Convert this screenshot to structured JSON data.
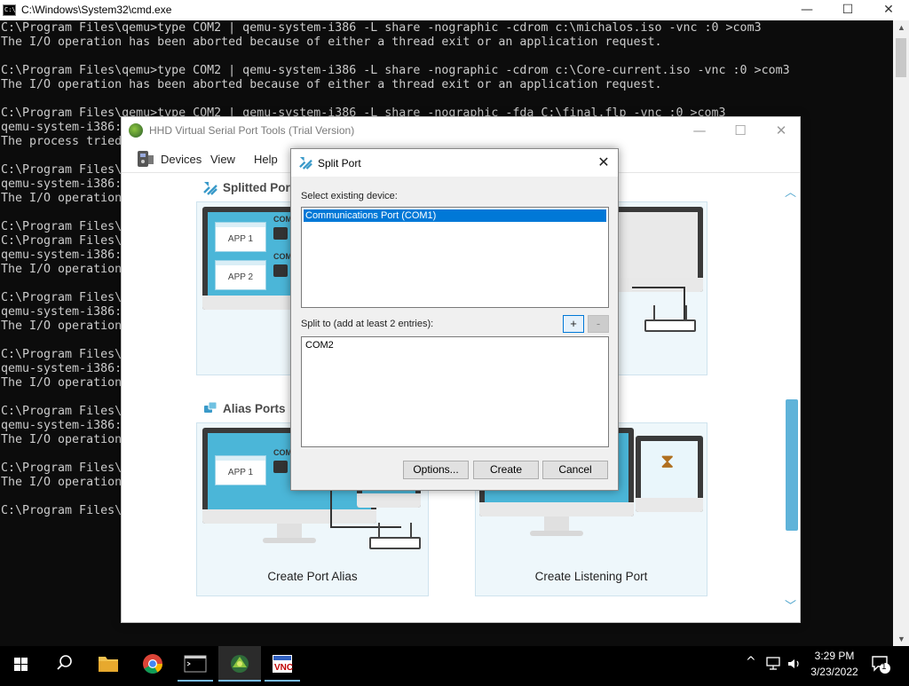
{
  "cmd": {
    "title": "C:\\Windows\\System32\\cmd.exe",
    "icon": "cmd-icon",
    "icon_text": "C:\\_",
    "lines": [
      "C:\\Program Files\\qemu>type COM2 | qemu-system-i386 -L share -nographic -cdrom c:\\michalos.iso -vnc :0 >com3",
      "The I/O operation has been aborted because of either a thread exit or an application request.",
      "",
      "C:\\Program Files\\qemu>type COM2 | qemu-system-i386 -L share -nographic -cdrom c:\\Core-current.iso -vnc :0 >com3",
      "The I/O operation has been aborted because of either a thread exit or an application request.",
      "",
      "C:\\Program Files\\qemu>type COM2 | qemu-system-i386 -L share -nographic -fda C:\\final.flp -vnc :0 >com3",
      "qemu-system-i386:",
      "The process tried",
      "",
      "C:\\Program Files\\",
      "qemu-system-i386:",
      "The I/O operation",
      "",
      "C:\\Program Files\\",
      "C:\\Program Files\\",
      "qemu-system-i386:",
      "The I/O operation",
      "",
      "C:\\Program Files\\",
      "qemu-system-i386:",
      "The I/O operation",
      "",
      "C:\\Program Files\\",
      "qemu-system-i386:",
      "The I/O operation",
      "",
      "C:\\Program Files\\",
      "qemu-system-i386:",
      "The I/O operation",
      "",
      "C:\\Program Files\\",
      "The I/O operation",
      "",
      "C:\\Program Files\\"
    ]
  },
  "caption": {
    "minimize": "—",
    "maximize": "☐",
    "close": "✕"
  },
  "hhd": {
    "title": "HHD Virtual Serial Port Tools (Trial Version)",
    "menu": {
      "devices": "Devices",
      "view": "View",
      "help": "Help"
    },
    "sections": {
      "splitted": "Splitted Port",
      "alias": "Alias Ports"
    },
    "cards": {
      "alias": "Create Port Alias",
      "listening": "Create Listening Port",
      "split_partial": "S"
    },
    "illustration": {
      "app1": "APP 1",
      "app2": "APP 2",
      "com": "COM"
    },
    "scroll": {
      "up": "︿",
      "down": "﹀"
    }
  },
  "dialog": {
    "title": "Split Port",
    "existing_label": "Select existing device:",
    "existing_items": [
      "Communications Port (COM1)"
    ],
    "split_label": "Split to (add at least 2 entries):",
    "add_label": "+",
    "remove_label": "-",
    "split_entries": [
      "COM2"
    ],
    "options_label": "Options...",
    "create_label": "Create",
    "cancel_label": "Cancel"
  },
  "taskbar": {
    "apps": [
      "start-icon",
      "search-icon",
      "file-explorer-icon",
      "chrome-icon",
      "cmd-icon",
      "hhd-serial-port-icon",
      "vnc-viewer-icon"
    ],
    "time": "3:29 PM",
    "date": "3/23/2022",
    "tray": {
      "chevron": "^",
      "network": "⎔",
      "volume": "🔈",
      "notifications": "💬",
      "notification_count": "1"
    }
  },
  "colors": {
    "accent": "#0078d7",
    "hhd_accent": "#4bb6d8",
    "console_bg": "#0c0c0c",
    "console_fg": "#cccccc"
  }
}
